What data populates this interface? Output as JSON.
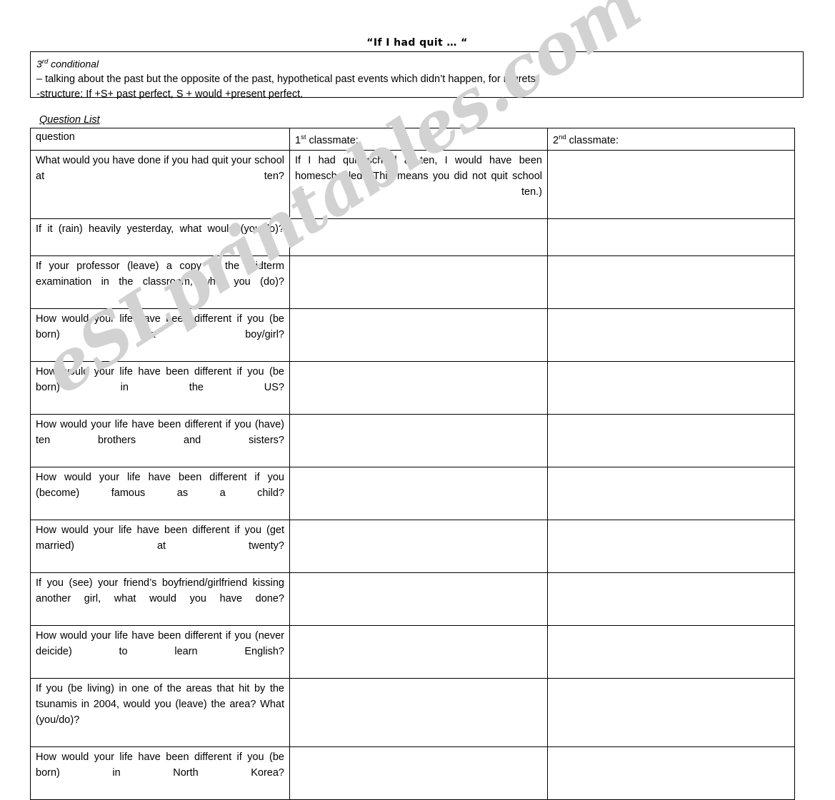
{
  "document": {
    "title": "“If I had quit … “",
    "watermark": "eSLprintables.com"
  },
  "grammar_box": {
    "heading_main": "3",
    "heading_sup": "rd",
    "heading_rest": " conditional",
    "line_1": "– talking about the past but the opposite of the past, hypothetical past events which didn’t happen, for regrets",
    "line_2": "-structure: If +S+ past perfect, S + would +present perfect."
  },
  "section": {
    "label": "Question List"
  },
  "table": {
    "headers": {
      "question": "question",
      "first_classmate_num": "1",
      "first_classmate_sup": "st",
      "first_classmate_rest": " classmate:",
      "second_classmate_num": "2",
      "second_classmate_sup": "nd",
      "second_classmate_rest": " classmate:"
    },
    "rows": [
      {
        "question": "What would you have done if you had quit your school at ten?",
        "first_classmate": "If I had quit school at ten, I would have been homeschooled. (This means you did not quit school at ten.)",
        "second_classmate": ""
      },
      {
        "question": "If it (rain) heavily yesterday, what would (you/do)?",
        "first_classmate": "",
        "second_classmate": ""
      },
      {
        "question": "If your professor (leave) a copy of the midterm examination in the classroom, what you (do)?",
        "first_classmate": "",
        "second_classmate": ""
      },
      {
        "question": "How would your life have been different if you (be born) a boy/girl?",
        "first_classmate": "",
        "second_classmate": ""
      },
      {
        "question": "How would your life have been different if you (be born) in the US?",
        "first_classmate": "",
        "second_classmate": ""
      },
      {
        "question": "How would your life have been different if you (have) ten brothers and sisters?",
        "first_classmate": "",
        "second_classmate": ""
      },
      {
        "question": "How would your life have been different if you (become) famous as a child?",
        "first_classmate": "",
        "second_classmate": ""
      },
      {
        "question": "How would your life have been different if you (get married) at twenty?",
        "first_classmate": "",
        "second_classmate": ""
      },
      {
        "question": "If you (see) your friend’s boyfriend/girlfriend kissing another girl, what would you have done?",
        "first_classmate": "",
        "second_classmate": ""
      },
      {
        "question": "How would your life have been different if you (never deicide) to learn English?",
        "first_classmate": "",
        "second_classmate": ""
      },
      {
        "question": "If you (be living) in one of the areas that hit by the tsunamis in 2004, would you (leave) the area? What (you/do)?",
        "first_classmate": "",
        "second_classmate": ""
      },
      {
        "question": "How would your life have been different if you (be born) in North Korea?",
        "first_classmate": "",
        "second_classmate": ""
      }
    ]
  }
}
